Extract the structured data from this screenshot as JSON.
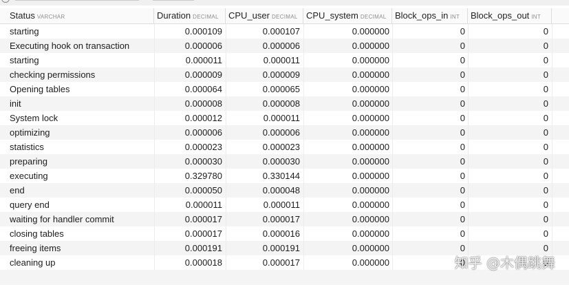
{
  "columns": [
    {
      "name": "Status",
      "type": "VARCHAR"
    },
    {
      "name": "Duration",
      "type": "DECIMAL"
    },
    {
      "name": "CPU_user",
      "type": "DECIMAL"
    },
    {
      "name": "CPU_system",
      "type": "DECIMAL"
    },
    {
      "name": "Block_ops_in",
      "type": "INT"
    },
    {
      "name": "Block_ops_out",
      "type": "INT"
    }
  ],
  "rows": [
    {
      "status": "starting",
      "duration": "0.000109",
      "cpu_user": "0.000107",
      "cpu_system": "0.000000",
      "block_ops_in": "0",
      "block_ops_out": "0"
    },
    {
      "status": "Executing hook on transaction",
      "duration": "0.000006",
      "cpu_user": "0.000006",
      "cpu_system": "0.000000",
      "block_ops_in": "0",
      "block_ops_out": "0"
    },
    {
      "status": "starting",
      "duration": "0.000011",
      "cpu_user": "0.000011",
      "cpu_system": "0.000000",
      "block_ops_in": "0",
      "block_ops_out": "0"
    },
    {
      "status": "checking permissions",
      "duration": "0.000009",
      "cpu_user": "0.000009",
      "cpu_system": "0.000000",
      "block_ops_in": "0",
      "block_ops_out": "0"
    },
    {
      "status": "Opening tables",
      "duration": "0.000064",
      "cpu_user": "0.000065",
      "cpu_system": "0.000000",
      "block_ops_in": "0",
      "block_ops_out": "0"
    },
    {
      "status": "init",
      "duration": "0.000008",
      "cpu_user": "0.000008",
      "cpu_system": "0.000000",
      "block_ops_in": "0",
      "block_ops_out": "0"
    },
    {
      "status": "System lock",
      "duration": "0.000012",
      "cpu_user": "0.000011",
      "cpu_system": "0.000000",
      "block_ops_in": "0",
      "block_ops_out": "0"
    },
    {
      "status": "optimizing",
      "duration": "0.000006",
      "cpu_user": "0.000006",
      "cpu_system": "0.000000",
      "block_ops_in": "0",
      "block_ops_out": "0"
    },
    {
      "status": "statistics",
      "duration": "0.000023",
      "cpu_user": "0.000023",
      "cpu_system": "0.000000",
      "block_ops_in": "0",
      "block_ops_out": "0"
    },
    {
      "status": "preparing",
      "duration": "0.000030",
      "cpu_user": "0.000030",
      "cpu_system": "0.000000",
      "block_ops_in": "0",
      "block_ops_out": "0"
    },
    {
      "status": "executing",
      "duration": "0.329780",
      "cpu_user": "0.330144",
      "cpu_system": "0.000000",
      "block_ops_in": "0",
      "block_ops_out": "0"
    },
    {
      "status": "end",
      "duration": "0.000050",
      "cpu_user": "0.000048",
      "cpu_system": "0.000000",
      "block_ops_in": "0",
      "block_ops_out": "0"
    },
    {
      "status": "query end",
      "duration": "0.000011",
      "cpu_user": "0.000011",
      "cpu_system": "0.000000",
      "block_ops_in": "0",
      "block_ops_out": "0"
    },
    {
      "status": "waiting for handler commit",
      "duration": "0.000017",
      "cpu_user": "0.000017",
      "cpu_system": "0.000000",
      "block_ops_in": "0",
      "block_ops_out": "0"
    },
    {
      "status": "closing tables",
      "duration": "0.000017",
      "cpu_user": "0.000016",
      "cpu_system": "0.000000",
      "block_ops_in": "0",
      "block_ops_out": "0"
    },
    {
      "status": "freeing items",
      "duration": "0.000191",
      "cpu_user": "0.000191",
      "cpu_system": "0.000000",
      "block_ops_in": "0",
      "block_ops_out": "0"
    },
    {
      "status": "cleaning up",
      "duration": "0.000018",
      "cpu_user": "0.000017",
      "cpu_system": "0.000000",
      "block_ops_in": "0",
      "block_ops_out": "0"
    }
  ],
  "watermark": "知乎 @木偶跳舞"
}
